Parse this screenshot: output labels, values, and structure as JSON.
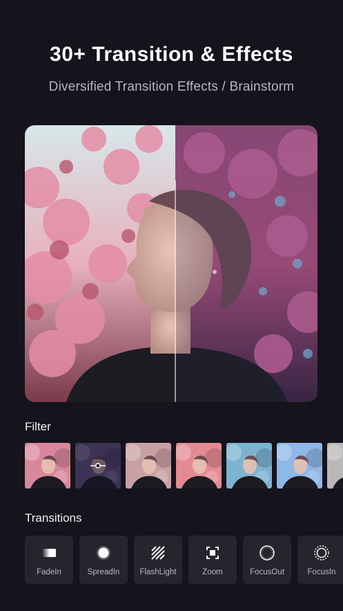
{
  "header": {
    "title": "30+ Transition & Effects",
    "subtitle": "Diversified Transition Effects / Brainstorm"
  },
  "filter": {
    "title": "Filter",
    "items": [
      {
        "tone": "#d9879b"
      },
      {
        "tone": "#6b5a8a",
        "selected": true
      },
      {
        "tone": "#c9a1a4"
      },
      {
        "tone": "#e38a92"
      },
      {
        "tone": "#7bb3d0"
      },
      {
        "tone": "#8db8e8"
      },
      {
        "tone": "#b8b8b8"
      }
    ]
  },
  "transitions": {
    "title": "Transitions",
    "items": [
      {
        "label": "FadeIn",
        "icon": "fade-icon"
      },
      {
        "label": "SpreadIn",
        "icon": "spread-icon"
      },
      {
        "label": "FlashLight",
        "icon": "flashlight-icon"
      },
      {
        "label": "Zoom",
        "icon": "zoom-icon"
      },
      {
        "label": "FocusOut",
        "icon": "focus-out-icon"
      },
      {
        "label": "FocusIn",
        "icon": "focus-in-icon"
      }
    ]
  },
  "colors": {
    "background": "#15131b",
    "card": "#26242d",
    "blossom": "#d97c98",
    "sky": "#a8d6e6"
  }
}
